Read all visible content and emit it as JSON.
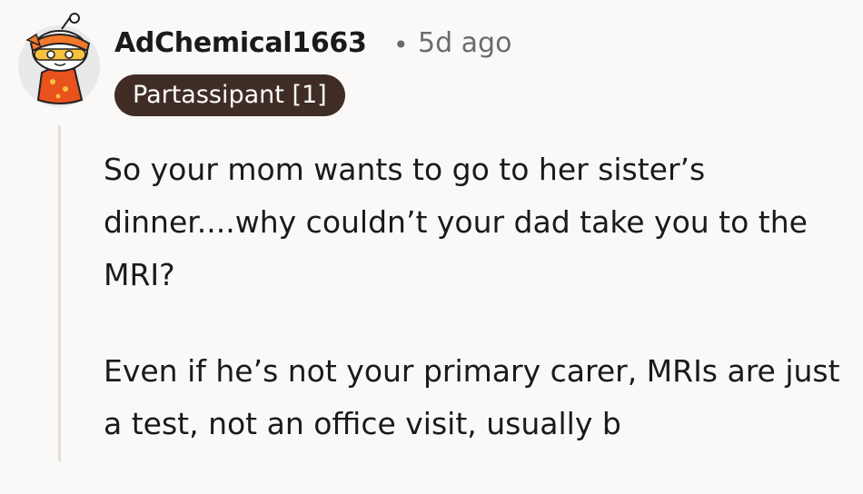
{
  "comment": {
    "author": "AdChemical1663",
    "separator": "•",
    "time_ago": "5d ago",
    "flair": "Partassipant [1]",
    "paragraphs": [
      "So your mom wants to go to her sister’s dinner....why couldn’t your dad take you to the MRI?",
      "Even if he’s not your primary carer, MRIs are just a test, not an office visit, usually b"
    ]
  },
  "avatar": {
    "icon": "snoo-avatar-icon",
    "colors": {
      "hair": "#f2792c",
      "headband": "#ffffff",
      "shirt": "#e9521d",
      "background": "#e9e9ea"
    }
  }
}
